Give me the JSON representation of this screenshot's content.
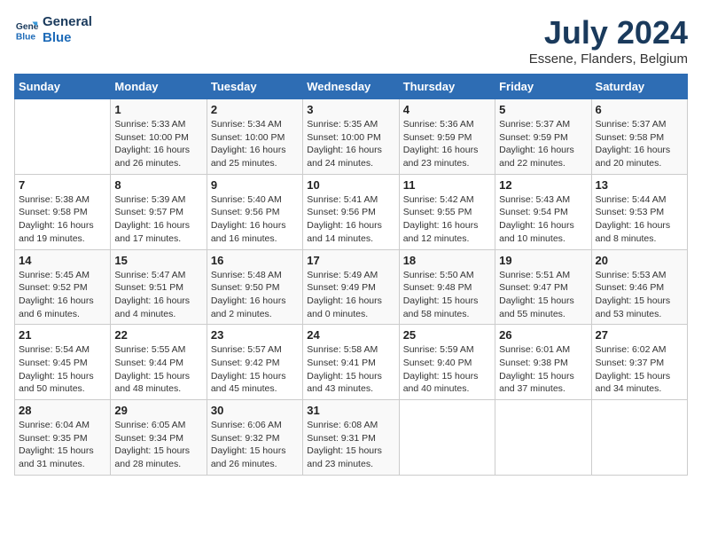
{
  "logo": {
    "line1": "General",
    "line2": "Blue"
  },
  "title": "July 2024",
  "location": "Essene, Flanders, Belgium",
  "days_header": [
    "Sunday",
    "Monday",
    "Tuesday",
    "Wednesday",
    "Thursday",
    "Friday",
    "Saturday"
  ],
  "weeks": [
    [
      {
        "day": "",
        "info": ""
      },
      {
        "day": "1",
        "info": "Sunrise: 5:33 AM\nSunset: 10:00 PM\nDaylight: 16 hours\nand 26 minutes."
      },
      {
        "day": "2",
        "info": "Sunrise: 5:34 AM\nSunset: 10:00 PM\nDaylight: 16 hours\nand 25 minutes."
      },
      {
        "day": "3",
        "info": "Sunrise: 5:35 AM\nSunset: 10:00 PM\nDaylight: 16 hours\nand 24 minutes."
      },
      {
        "day": "4",
        "info": "Sunrise: 5:36 AM\nSunset: 9:59 PM\nDaylight: 16 hours\nand 23 minutes."
      },
      {
        "day": "5",
        "info": "Sunrise: 5:37 AM\nSunset: 9:59 PM\nDaylight: 16 hours\nand 22 minutes."
      },
      {
        "day": "6",
        "info": "Sunrise: 5:37 AM\nSunset: 9:58 PM\nDaylight: 16 hours\nand 20 minutes."
      }
    ],
    [
      {
        "day": "7",
        "info": "Sunrise: 5:38 AM\nSunset: 9:58 PM\nDaylight: 16 hours\nand 19 minutes."
      },
      {
        "day": "8",
        "info": "Sunrise: 5:39 AM\nSunset: 9:57 PM\nDaylight: 16 hours\nand 17 minutes."
      },
      {
        "day": "9",
        "info": "Sunrise: 5:40 AM\nSunset: 9:56 PM\nDaylight: 16 hours\nand 16 minutes."
      },
      {
        "day": "10",
        "info": "Sunrise: 5:41 AM\nSunset: 9:56 PM\nDaylight: 16 hours\nand 14 minutes."
      },
      {
        "day": "11",
        "info": "Sunrise: 5:42 AM\nSunset: 9:55 PM\nDaylight: 16 hours\nand 12 minutes."
      },
      {
        "day": "12",
        "info": "Sunrise: 5:43 AM\nSunset: 9:54 PM\nDaylight: 16 hours\nand 10 minutes."
      },
      {
        "day": "13",
        "info": "Sunrise: 5:44 AM\nSunset: 9:53 PM\nDaylight: 16 hours\nand 8 minutes."
      }
    ],
    [
      {
        "day": "14",
        "info": "Sunrise: 5:45 AM\nSunset: 9:52 PM\nDaylight: 16 hours\nand 6 minutes."
      },
      {
        "day": "15",
        "info": "Sunrise: 5:47 AM\nSunset: 9:51 PM\nDaylight: 16 hours\nand 4 minutes."
      },
      {
        "day": "16",
        "info": "Sunrise: 5:48 AM\nSunset: 9:50 PM\nDaylight: 16 hours\nand 2 minutes."
      },
      {
        "day": "17",
        "info": "Sunrise: 5:49 AM\nSunset: 9:49 PM\nDaylight: 16 hours\nand 0 minutes."
      },
      {
        "day": "18",
        "info": "Sunrise: 5:50 AM\nSunset: 9:48 PM\nDaylight: 15 hours\nand 58 minutes."
      },
      {
        "day": "19",
        "info": "Sunrise: 5:51 AM\nSunset: 9:47 PM\nDaylight: 15 hours\nand 55 minutes."
      },
      {
        "day": "20",
        "info": "Sunrise: 5:53 AM\nSunset: 9:46 PM\nDaylight: 15 hours\nand 53 minutes."
      }
    ],
    [
      {
        "day": "21",
        "info": "Sunrise: 5:54 AM\nSunset: 9:45 PM\nDaylight: 15 hours\nand 50 minutes."
      },
      {
        "day": "22",
        "info": "Sunrise: 5:55 AM\nSunset: 9:44 PM\nDaylight: 15 hours\nand 48 minutes."
      },
      {
        "day": "23",
        "info": "Sunrise: 5:57 AM\nSunset: 9:42 PM\nDaylight: 15 hours\nand 45 minutes."
      },
      {
        "day": "24",
        "info": "Sunrise: 5:58 AM\nSunset: 9:41 PM\nDaylight: 15 hours\nand 43 minutes."
      },
      {
        "day": "25",
        "info": "Sunrise: 5:59 AM\nSunset: 9:40 PM\nDaylight: 15 hours\nand 40 minutes."
      },
      {
        "day": "26",
        "info": "Sunrise: 6:01 AM\nSunset: 9:38 PM\nDaylight: 15 hours\nand 37 minutes."
      },
      {
        "day": "27",
        "info": "Sunrise: 6:02 AM\nSunset: 9:37 PM\nDaylight: 15 hours\nand 34 minutes."
      }
    ],
    [
      {
        "day": "28",
        "info": "Sunrise: 6:04 AM\nSunset: 9:35 PM\nDaylight: 15 hours\nand 31 minutes."
      },
      {
        "day": "29",
        "info": "Sunrise: 6:05 AM\nSunset: 9:34 PM\nDaylight: 15 hours\nand 28 minutes."
      },
      {
        "day": "30",
        "info": "Sunrise: 6:06 AM\nSunset: 9:32 PM\nDaylight: 15 hours\nand 26 minutes."
      },
      {
        "day": "31",
        "info": "Sunrise: 6:08 AM\nSunset: 9:31 PM\nDaylight: 15 hours\nand 23 minutes."
      },
      {
        "day": "",
        "info": ""
      },
      {
        "day": "",
        "info": ""
      },
      {
        "day": "",
        "info": ""
      }
    ]
  ]
}
